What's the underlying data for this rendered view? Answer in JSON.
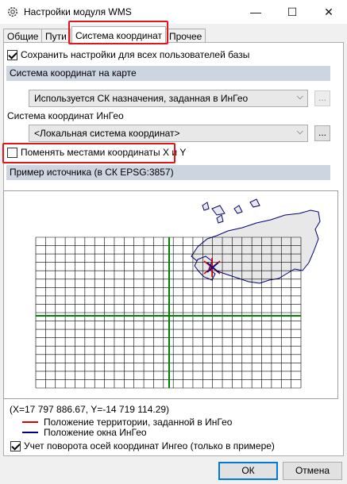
{
  "window": {
    "title": "Настройки модуля WMS",
    "minimize_glyph": "—",
    "maximize_glyph": "☐",
    "close_glyph": "✕"
  },
  "tabs": [
    {
      "label": "Общие",
      "active": false
    },
    {
      "label": "Пути",
      "active": false
    },
    {
      "label": "Система координат",
      "active": true
    },
    {
      "label": "Прочее",
      "active": false
    }
  ],
  "settings": {
    "save_for_all_label": "Сохранить настройки для всех пользователей базы",
    "save_for_all_checked": true,
    "map_cs_section": "Система координат на карте",
    "map_cs_value": "Используется СК назначения, заданная в ИнГео",
    "dots_label": "...",
    "ingeo_cs_label": "Система координат ИнГео",
    "ingeo_cs_value": "<Локальная система координат>",
    "swap_xy_label": "Поменять местами координаты X и Y",
    "swap_xy_checked": false,
    "example_section": "Пример источника (в СК EPSG:3857)"
  },
  "preview": {
    "coordinates": "(X=17 797 886.67, Y=-14 719 114.29)",
    "legend": [
      {
        "label": "Положение территории, заданной в ИнГео",
        "color": "#e00000"
      },
      {
        "label": "Положение окна ИнГео",
        "color": "#00008b"
      }
    ],
    "axis_color": "#008000",
    "grid_color": "#000000",
    "map_outline_color": "#00007a"
  },
  "rotation": {
    "label": "Учет поворота осей координат Ингео (только в примере)",
    "checked": true
  },
  "buttons": {
    "ok": "ОК",
    "cancel": "Отмена"
  }
}
